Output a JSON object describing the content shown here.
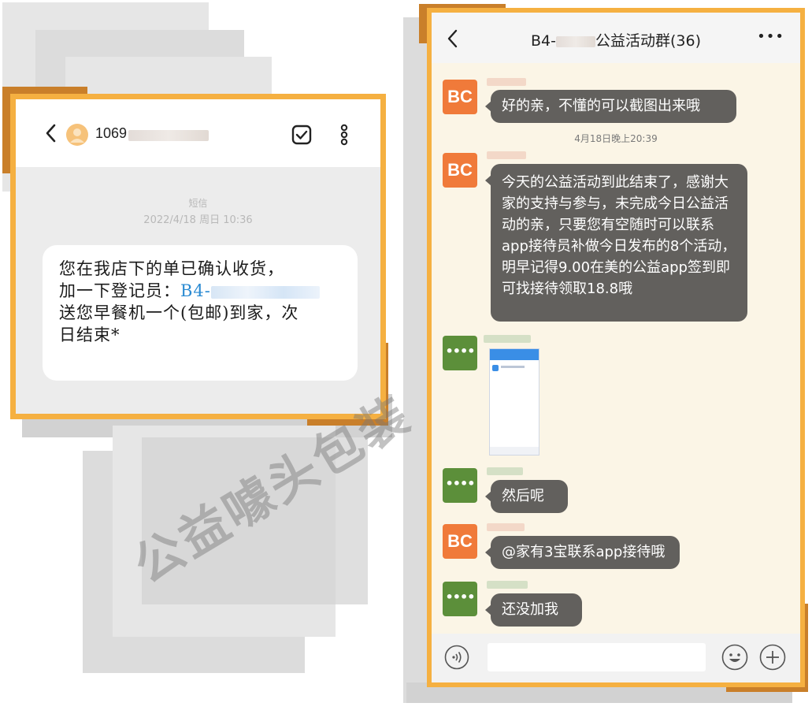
{
  "sms": {
    "contact_number": "1069",
    "type_label": "短信",
    "timestamp": "2022/4/18 周日 10:36",
    "message_line1": "您在我店下的单已确认收货，",
    "message_line2_prefix": "加一下登记员：",
    "message_line2_link": "B4-",
    "message_line3": "送您早餐机一个(包邮)到家，次",
    "message_line4": "日结束*"
  },
  "watermark": "公益噱头包装",
  "chat": {
    "title_prefix": "B4-",
    "title_suffix": "公益活动群(36)",
    "more_label": "•••",
    "timestamp": "4月18日晚上20:39",
    "avatar_bc_label": "BC",
    "avatar_dots_label": "••••",
    "messages": [
      {
        "text": "好的亲，不懂的可以截图出来哦"
      },
      {
        "text": "今天的公益活动到此结束了，感谢大家的支持与参与，未完成今日公益活动的亲，只要您有空随时可以联系app接待员补做今日发布的8个活动，明早记得9.00在美的公益app签到即可找接待领取18.8哦"
      },
      {
        "text": "然后呢"
      },
      {
        "text": "@家有3宝联系app接待哦"
      },
      {
        "text": "还没加我"
      }
    ]
  },
  "colors": {
    "frame": "#f5b041",
    "bubble": "#62605d",
    "avatar_bc": "#f07a3a",
    "avatar_green": "#5c8f3a",
    "link_blue": "#2a8ad2"
  },
  "icons": [
    "back-chevron-icon",
    "contact-avatar-icon",
    "checkbox-icon",
    "kebab-menu-icon",
    "voice-icon",
    "emoji-icon",
    "plus-icon"
  ]
}
